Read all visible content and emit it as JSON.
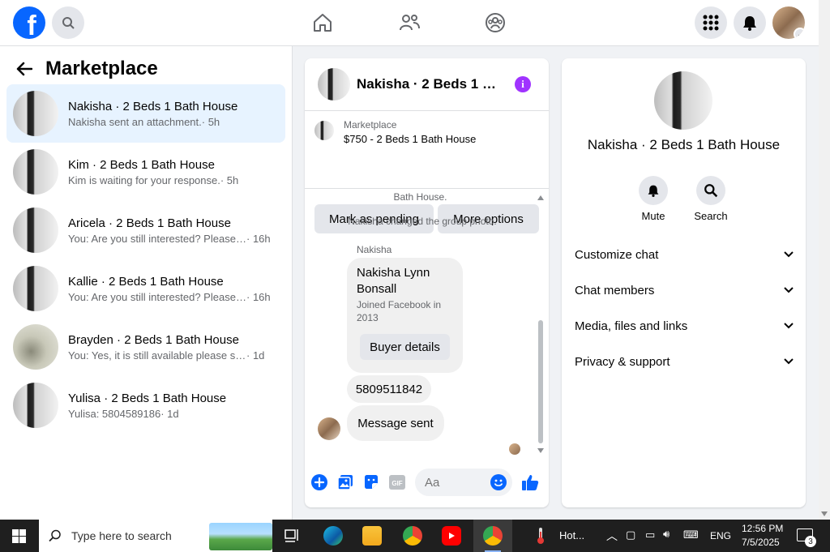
{
  "colors": {
    "brand": "#0866ff",
    "accent_purple": "#a033ff",
    "active_bg": "#e7f3ff"
  },
  "topbar": {
    "logo_icon": "facebook-logo",
    "search_icon": "search-icon",
    "nav": [
      "home-icon",
      "friends-icon",
      "groups-icon"
    ],
    "menu_icon": "grid-menu-icon",
    "bell_icon": "bell-icon"
  },
  "left": {
    "title": "Marketplace",
    "conversations": [
      {
        "name": "Nakisha · 2 Beds 1 Bath House",
        "snippet": "Nakisha sent an attachment.",
        "time": " · 5h",
        "active": true
      },
      {
        "name": "Kim · 2 Beds 1 Bath House",
        "snippet": "Kim is waiting for your response.",
        "time": " · 5h"
      },
      {
        "name": "Aricela · 2 Beds 1 Bath House",
        "snippet": "You: Are you still interested? Please s...",
        "time": " · 16h"
      },
      {
        "name": "Kallie · 2 Beds 1 Bath House",
        "snippet": "You: Are you still interested? Please s...",
        "time": " · 16h"
      },
      {
        "name": "Brayden · 2 Beds 1 Bath House",
        "snippet": "You: Yes, it is still available please sen...",
        "time": " · 1d"
      },
      {
        "name": "Yulisa · 2 Beds 1 Bath House",
        "snippet": "Yulisa: 5804589186",
        "time": " · 1d"
      }
    ]
  },
  "chat": {
    "title": "Nakisha · 2 Beds 1 Ba...",
    "listing_source": "Marketplace",
    "listing_price": "$750 - 2 Beds 1 Bath House",
    "pending_btn": "Mark as pending",
    "options_btn": "More options",
    "sys_partial": "Bath House.",
    "sys_photo": "Nakisha changed the group photo.",
    "sender": "Nakisha",
    "card_name": "Nakisha Lynn Bonsall",
    "card_joined": "Joined Facebook in 2013",
    "buyer_btn": "Buyer details",
    "phone": "5809511842",
    "sent_msg": "Message sent",
    "input_placeholder": "Aa"
  },
  "info": {
    "name": "Nakisha · 2 Beds 1 Bath House",
    "mute": "Mute",
    "search": "Search",
    "sections": [
      "Customize chat",
      "Chat members",
      "Media, files and links",
      "Privacy & support"
    ]
  },
  "taskbar": {
    "search_placeholder": "Type here to search",
    "weather": "Hot...",
    "lang": "ENG",
    "time": "12:56 PM",
    "date": "7/5/2025",
    "notif_count": "3"
  }
}
